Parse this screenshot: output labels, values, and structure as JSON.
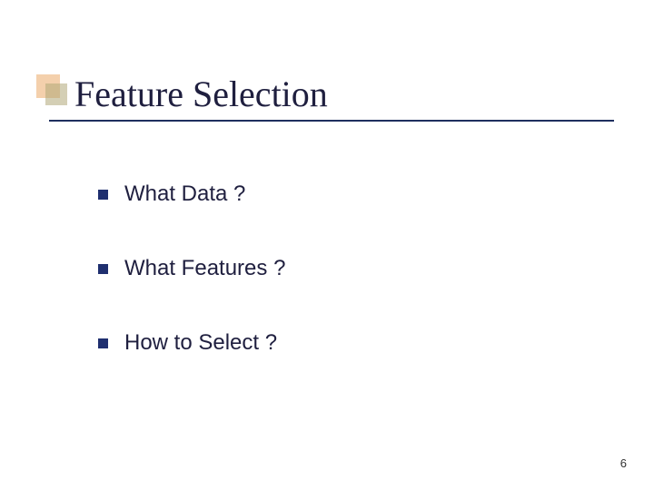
{
  "slide": {
    "title": "Feature Selection",
    "bullets": [
      {
        "text": "What Data ?"
      },
      {
        "text": "What Features ?"
      },
      {
        "text": "How to Select ?"
      }
    ],
    "page_number": "6"
  }
}
